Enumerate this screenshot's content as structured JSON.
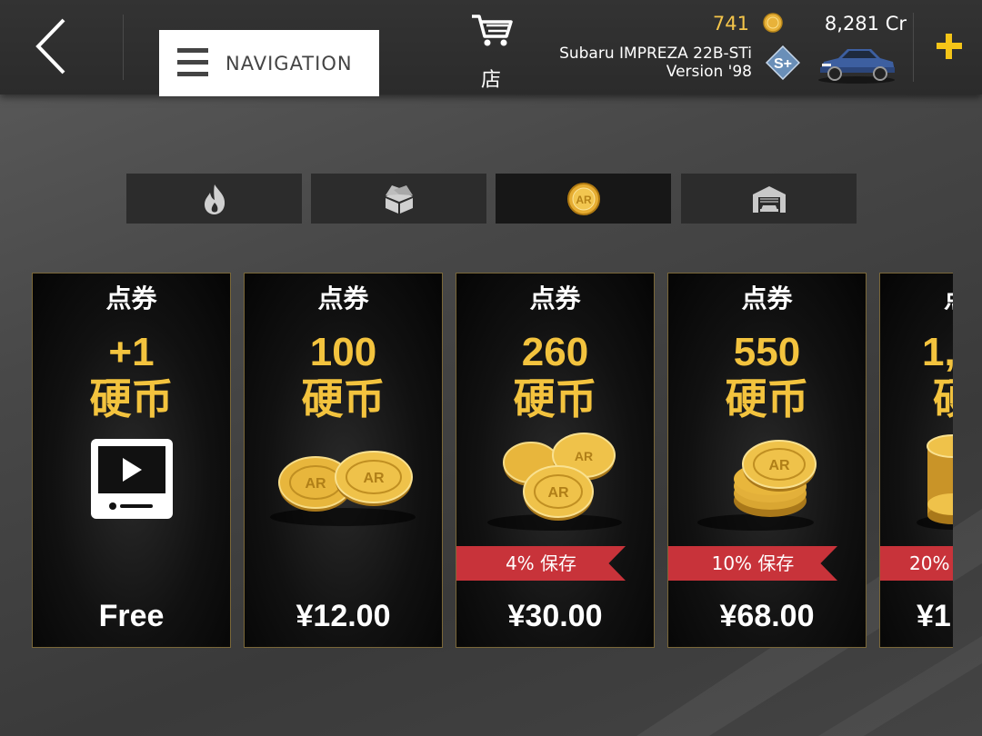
{
  "header": {
    "nav_label": "NAVIGATION",
    "store_label": "店",
    "coins": "741",
    "credits": "8,281 Cr",
    "car_name_line1": "Subaru IMPREZA 22B-STi",
    "car_name_line2": "Version '98",
    "car_class": "S+"
  },
  "tabs": [
    {
      "icon": "flame-icon",
      "active": false
    },
    {
      "icon": "box-icon",
      "active": false
    },
    {
      "icon": "coin-icon",
      "active": true
    },
    {
      "icon": "garage-icon",
      "active": false
    }
  ],
  "cards": [
    {
      "type": "点券",
      "amount": "+1",
      "unit": "硬币",
      "art": "video-ad-icon",
      "ribbon": "",
      "price": "Free"
    },
    {
      "type": "点券",
      "amount": "100",
      "unit": "硬币",
      "art": "two-coins",
      "ribbon": "",
      "price": "¥12.00"
    },
    {
      "type": "点券",
      "amount": "260",
      "unit": "硬币",
      "art": "coin-pile",
      "ribbon": "4% 保存",
      "price": "¥30.00"
    },
    {
      "type": "点券",
      "amount": "550",
      "unit": "硬币",
      "art": "coin-stack",
      "ribbon": "10% 保存",
      "price": "¥68.00"
    },
    {
      "type": "点",
      "amount": "1,",
      "unit": "硬",
      "art": "coin-tower",
      "ribbon": "20%",
      "price": "¥1"
    }
  ],
  "colors": {
    "gold": "#f3c33e",
    "ribbon": "#c8333a",
    "accent_plus": "#f5c518"
  }
}
